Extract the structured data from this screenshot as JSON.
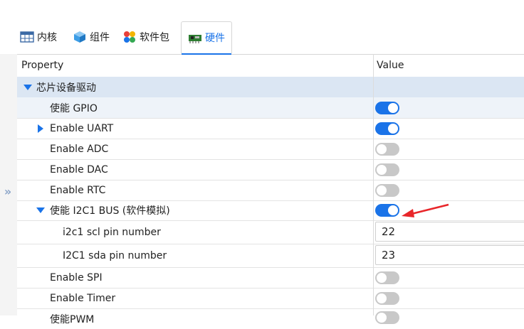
{
  "tabs": [
    {
      "label": "内核",
      "icon": "table-icon"
    },
    {
      "label": "组件",
      "icon": "cube-icon"
    },
    {
      "label": "软件包",
      "icon": "packages-icon"
    },
    {
      "label": "硬件",
      "icon": "board-icon",
      "active": true
    }
  ],
  "grid": {
    "header": {
      "property": "Property",
      "value": "Value"
    },
    "category": {
      "label": "芯片设备驱动"
    },
    "rows": {
      "gpio": {
        "label": "使能 GPIO",
        "enabled": true
      },
      "uart": {
        "label": "Enable UART",
        "enabled": true
      },
      "adc": {
        "label": "Enable ADC",
        "enabled": false
      },
      "dac": {
        "label": "Enable DAC",
        "enabled": false
      },
      "rtc": {
        "label": "Enable RTC",
        "enabled": false
      },
      "i2c1": {
        "label": "使能 I2C1 BUS (软件模拟)",
        "enabled": true
      },
      "scl": {
        "label": "i2c1 scl pin number",
        "value": "22"
      },
      "sda": {
        "label": "I2C1 sda pin number",
        "value": "23"
      },
      "spi": {
        "label": "Enable SPI",
        "enabled": false
      },
      "timer": {
        "label": "Enable Timer",
        "enabled": false
      },
      "pwm": {
        "label": "使能PWM",
        "enabled": false
      }
    }
  },
  "colors": {
    "accent": "#1a73e8",
    "annotation_arrow": "#e8262a",
    "category_bg": "#dbe6f3"
  }
}
